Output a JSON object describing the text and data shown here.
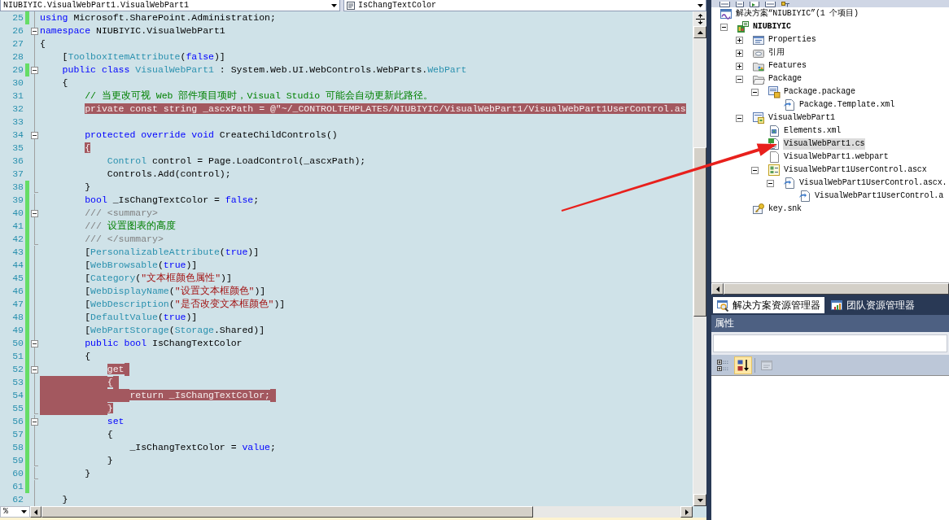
{
  "editor": {
    "type_selector": "NIUBIYIC.VisualWebPart1.VisualWebPart1",
    "member_selector": "IsChangTextColor",
    "lines": [
      {
        "number": "25",
        "kind": "body",
        "changed": true,
        "selected": false,
        "tokens": [
          {
            "text": "using",
            "kind": "keyword",
            "highlighted": false
          },
          {
            "text": " Microsoft.SharePoint.Administration;",
            "kind": "plain",
            "highlighted": false
          }
        ]
      },
      {
        "number": "26",
        "kind": "start",
        "changed": false,
        "selected": false,
        "tokens": [
          {
            "text": "namespace",
            "kind": "keyword",
            "highlighted": false
          },
          {
            "text": " NIUBIYIC.VisualWebPart1",
            "kind": "plain",
            "highlighted": false
          }
        ]
      },
      {
        "number": "27",
        "kind": "body",
        "changed": false,
        "selected": false,
        "tokens": [
          {
            "text": "{",
            "kind": "plain",
            "highlighted": false
          }
        ],
        "children": [
          {
            "number": "28",
            "kind": "body",
            "changed": false,
            "selected": false,
            "tokens": [
              {
                "text": "[",
                "kind": "plain",
                "highlighted": false
              },
              {
                "text": "ToolboxItemAttribute",
                "kind": "type",
                "highlighted": false
              },
              {
                "text": "(",
                "kind": "plain",
                "highlighted": false
              },
              {
                "text": "false",
                "kind": "keyword",
                "highlighted": false
              },
              {
                "text": ")]",
                "kind": "plain",
                "highlighted": false
              }
            ]
          },
          {
            "number": "29",
            "kind": "start",
            "changed": true,
            "selected": false,
            "tokens": [
              {
                "text": "public class ",
                "kind": "keyword",
                "highlighted": false
              },
              {
                "text": "VisualWebPart1",
                "kind": "type",
                "highlighted": false
              },
              {
                "text": " : System.Web.UI.WebControls.WebParts.",
                "kind": "plain",
                "highlighted": false
              },
              {
                "text": "WebPart",
                "kind": "type",
                "highlighted": false
              }
            ]
          },
          {
            "number": "30",
            "kind": "body",
            "changed": false,
            "selected": false,
            "tokens": [
              {
                "text": "{",
                "kind": "plain",
                "highlighted": false
              }
            ],
            "children": [
              {
                "number": "31",
                "kind": "body",
                "changed": false,
                "selected": false,
                "tokens": [
                  {
                    "text": "// 当更改可视 Web 部件项目项时，Visual Studio 可能会自动更新此路径。",
                    "kind": "comment",
                    "highlighted": false
                  }
                ]
              },
              {
                "number": "32",
                "kind": "body",
                "changed": false,
                "selected": false,
                "tokens": [
                  {
                    "text": "private const string",
                    "kind": "keyword",
                    "highlighted": true
                  },
                  {
                    "text": " _ascxPath = ",
                    "kind": "plain",
                    "highlighted": true
                  },
                  {
                    "text": "@\"~/_CONTROLTEMPLATES/NIUBIYIC/VisualWebPart1/VisualWebPart1UserControl.as",
                    "kind": "string",
                    "highlighted": true
                  }
                ]
              },
              {
                "number": "33",
                "kind": "body",
                "changed": false,
                "selected": false
              },
              {
                "number": "34",
                "kind": "start",
                "changed": false,
                "selected": false,
                "tokens": [
                  {
                    "text": "protected override void",
                    "kind": "keyword",
                    "highlighted": false
                  },
                  {
                    "text": " CreateChildControls()",
                    "kind": "plain",
                    "highlighted": false
                  }
                ]
              },
              {
                "number": "35",
                "kind": "body",
                "changed": false,
                "selected": false,
                "tokens": [
                  {
                    "text": "{",
                    "kind": "plain",
                    "highlighted": true
                  }
                ],
                "children": [
                  {
                    "number": "36",
                    "kind": "body",
                    "changed": false,
                    "selected": false,
                    "tokens": [
                      {
                        "text": "Control",
                        "kind": "type",
                        "highlighted": false
                      },
                      {
                        "text": " control = Page.LoadControl(_ascxPath);",
                        "kind": "plain",
                        "highlighted": false
                      }
                    ]
                  },
                  {
                    "number": "37",
                    "kind": "body",
                    "changed": false,
                    "selected": false,
                    "tokens": [
                      {
                        "text": "Controls.Add(control);",
                        "kind": "plain",
                        "highlighted": false
                      }
                    ]
                  }
                ]
              },
              {
                "number": "38",
                "kind": "end",
                "changed": true,
                "selected": false,
                "tokens": [
                  {
                    "text": "}",
                    "kind": "plain",
                    "highlighted": false
                  }
                ]
              },
              {
                "number": "39",
                "kind": "body",
                "changed": true,
                "selected": false,
                "tokens": [
                  {
                    "text": "bool",
                    "kind": "keyword",
                    "highlighted": false
                  },
                  {
                    "text": " _IsChangTextColor = ",
                    "kind": "plain",
                    "highlighted": false
                  },
                  {
                    "text": "false",
                    "kind": "keyword",
                    "highlighted": false
                  },
                  {
                    "text": ";",
                    "kind": "plain",
                    "highlighted": false
                  }
                ]
              },
              {
                "number": "40",
                "kind": "start",
                "changed": true,
                "selected": false,
                "tokens": [
                  {
                    "text": "/// <summary>",
                    "kind": "doc",
                    "highlighted": false
                  }
                ]
              },
              {
                "number": "41",
                "kind": "body",
                "changed": true,
                "selected": false,
                "tokens": [
                  {
                    "text": "/// ",
                    "kind": "doc",
                    "highlighted": false
                  },
                  {
                    "text": "设置图表的高度",
                    "kind": "comment",
                    "highlighted": false
                  }
                ]
              },
              {
                "number": "42",
                "kind": "end",
                "changed": true,
                "selected": false,
                "tokens": [
                  {
                    "text": "/// </summary>",
                    "kind": "doc",
                    "highlighted": false
                  }
                ]
              },
              {
                "number": "43",
                "kind": "body",
                "changed": true,
                "selected": false,
                "tokens": [
                  {
                    "text": "[",
                    "kind": "plain",
                    "highlighted": false
                  },
                  {
                    "text": "PersonalizableAttribute",
                    "kind": "type",
                    "highlighted": false
                  },
                  {
                    "text": "(",
                    "kind": "plain",
                    "highlighted": false
                  },
                  {
                    "text": "true",
                    "kind": "keyword",
                    "highlighted": false
                  },
                  {
                    "text": ")]",
                    "kind": "plain",
                    "highlighted": false
                  }
                ]
              },
              {
                "number": "44",
                "kind": "body",
                "changed": true,
                "selected": false,
                "tokens": [
                  {
                    "text": "[",
                    "kind": "plain",
                    "highlighted": false
                  },
                  {
                    "text": "WebBrowsable",
                    "kind": "type",
                    "highlighted": false
                  },
                  {
                    "text": "(",
                    "kind": "plain",
                    "highlighted": false
                  },
                  {
                    "text": "true",
                    "kind": "keyword",
                    "highlighted": false
                  },
                  {
                    "text": ")]",
                    "kind": "plain",
                    "highlighted": false
                  }
                ]
              },
              {
                "number": "45",
                "kind": "body",
                "changed": true,
                "selected": false,
                "tokens": [
                  {
                    "text": "[",
                    "kind": "plain",
                    "highlighted": false
                  },
                  {
                    "text": "Category",
                    "kind": "type",
                    "highlighted": false
                  },
                  {
                    "text": "(",
                    "kind": "plain",
                    "highlighted": false
                  },
                  {
                    "text": "\"文本框颜色属性\"",
                    "kind": "string",
                    "highlighted": false
                  },
                  {
                    "text": ")]",
                    "kind": "plain",
                    "highlighted": false
                  }
                ]
              },
              {
                "number": "46",
                "kind": "body",
                "changed": true,
                "selected": false,
                "tokens": [
                  {
                    "text": "[",
                    "kind": "plain",
                    "highlighted": false
                  },
                  {
                    "text": "WebDisplayName",
                    "kind": "type",
                    "highlighted": false
                  },
                  {
                    "text": "(",
                    "kind": "plain",
                    "highlighted": false
                  },
                  {
                    "text": "\"设置文本框颜色\"",
                    "kind": "string",
                    "highlighted": false
                  },
                  {
                    "text": ")]",
                    "kind": "plain",
                    "highlighted": false
                  }
                ]
              },
              {
                "number": "47",
                "kind": "body",
                "changed": true,
                "selected": false,
                "tokens": [
                  {
                    "text": "[",
                    "kind": "plain",
                    "highlighted": false
                  },
                  {
                    "text": "WebDescription",
                    "kind": "type",
                    "highlighted": false
                  },
                  {
                    "text": "(",
                    "kind": "plain",
                    "highlighted": false
                  },
                  {
                    "text": "\"是否改变文本框颜色\"",
                    "kind": "string",
                    "highlighted": false
                  },
                  {
                    "text": ")]",
                    "kind": "plain",
                    "highlighted": false
                  }
                ]
              },
              {
                "number": "48",
                "kind": "body",
                "changed": true,
                "selected": false,
                "tokens": [
                  {
                    "text": "[",
                    "kind": "plain",
                    "highlighted": false
                  },
                  {
                    "text": "DefaultValue",
                    "kind": "type",
                    "highlighted": false
                  },
                  {
                    "text": "(",
                    "kind": "plain",
                    "highlighted": false
                  },
                  {
                    "text": "true",
                    "kind": "keyword",
                    "highlighted": false
                  },
                  {
                    "text": ")]",
                    "kind": "plain",
                    "highlighted": false
                  }
                ]
              },
              {
                "number": "49",
                "kind": "body",
                "changed": true,
                "selected": false,
                "tokens": [
                  {
                    "text": "[",
                    "kind": "plain",
                    "highlighted": false
                  },
                  {
                    "text": "WebPartStorage",
                    "kind": "type",
                    "highlighted": false
                  },
                  {
                    "text": "(",
                    "kind": "plain",
                    "highlighted": false
                  },
                  {
                    "text": "Storage",
                    "kind": "type",
                    "highlighted": false
                  },
                  {
                    "text": ".Shared)]",
                    "kind": "plain",
                    "highlighted": false
                  }
                ]
              },
              {
                "number": "50",
                "kind": "start",
                "changed": true,
                "selected": false,
                "tokens": [
                  {
                    "text": "public bool",
                    "kind": "keyword",
                    "highlighted": false
                  },
                  {
                    "text": " IsChangTextColor",
                    "kind": "plain",
                    "highlighted": false
                  }
                ]
              },
              {
                "number": "51",
                "kind": "body",
                "changed": true,
                "selected": false,
                "tokens": [
                  {
                    "text": "{",
                    "kind": "plain",
                    "highlighted": false
                  }
                ],
                "children": [
                  {
                    "number": "52",
                    "kind": "start",
                    "changed": true,
                    "selected": false,
                    "tokens": [
                      {
                        "text": "get",
                        "kind": "keyword",
                        "highlighted": true
                      }
                    ]
                  },
                  {
                    "number": "53",
                    "kind": "body",
                    "changed": true,
                    "selected": true,
                    "tokens": [
                      {
                        "text": "{",
                        "kind": "plain",
                        "highlighted": true
                      }
                    ],
                    "children": [
                      {
                        "number": "54",
                        "kind": "body",
                        "changed": true,
                        "selected": true,
                        "tokens": [
                          {
                            "text": "return",
                            "kind": "keyword",
                            "highlighted": true
                          },
                          {
                            "text": " _IsChangTextColor;",
                            "kind": "plain",
                            "highlighted": true
                          }
                        ]
                      }
                    ]
                  },
                  {
                    "number": "55",
                    "kind": "end",
                    "changed": true,
                    "selected": true,
                    "tokens": [
                      {
                        "text": "}",
                        "kind": "plain",
                        "highlighted": true
                      }
                    ]
                  },
                  {
                    "number": "56",
                    "kind": "start",
                    "changed": true,
                    "selected": false,
                    "tokens": [
                      {
                        "text": "set",
                        "kind": "keyword",
                        "highlighted": false
                      }
                    ]
                  },
                  {
                    "number": "57",
                    "kind": "body",
                    "changed": true,
                    "selected": false,
                    "tokens": [
                      {
                        "text": "{",
                        "kind": "plain",
                        "highlighted": false
                      }
                    ],
                    "children": [
                      {
                        "number": "58",
                        "kind": "body",
                        "changed": true,
                        "selected": false,
                        "tokens": [
                          {
                            "text": "_IsChangTextColor = ",
                            "kind": "plain",
                            "highlighted": false
                          },
                          {
                            "text": "value",
                            "kind": "keyword",
                            "highlighted": false
                          },
                          {
                            "text": ";",
                            "kind": "plain",
                            "highlighted": false
                          }
                        ]
                      }
                    ]
                  },
                  {
                    "number": "59",
                    "kind": "end",
                    "changed": true,
                    "selected": false,
                    "tokens": [
                      {
                        "text": "}",
                        "kind": "plain",
                        "highlighted": false
                      }
                    ]
                  }
                ]
              },
              {
                "number": "60",
                "kind": "end",
                "changed": true,
                "selected": false,
                "tokens": [
                  {
                    "text": "}",
                    "kind": "plain",
                    "highlighted": false
                  }
                ]
              },
              {
                "number": "61",
                "kind": "body",
                "changed": true,
                "selected": false
              }
            ]
          },
          {
            "number": "62",
            "kind": "body",
            "changed": false,
            "selected": false,
            "tokens": [
              {
                "text": "}",
                "kind": "plain",
                "highlighted": false
              }
            ]
          }
        ]
      }
    ],
    "zoom": "%"
  },
  "solution_explorer": {
    "tree": {
      "label": "解决方案“NIUBIYIC”(1 个项目)",
      "kind": "solution",
      "selected": false,
      "children": [
        {
          "label": "NIUBIYIC",
          "kind": "project",
          "selected": false,
          "expanded": true,
          "children": [
            {
              "label": "Properties",
              "kind": "properties",
              "selected": false,
              "expanded": false
            },
            {
              "label": "引用",
              "kind": "references",
              "selected": false,
              "expanded": false
            },
            {
              "label": "Features",
              "kind": "features",
              "selected": false,
              "expanded": false
            },
            {
              "label": "Package",
              "kind": "folder",
              "selected": false,
              "expanded": true,
              "children": [
                {
                  "label": "Package.package",
                  "kind": "package",
                  "selected": false,
                  "expanded": true,
                  "children": [
                    {
                      "label": "Package.Template.xml",
                      "kind": "linked",
                      "selected": false
                    }
                  ]
                }
              ]
            },
            {
              "label": "VisualWebPart1",
              "kind": "webpart",
              "selected": false,
              "expanded": true,
              "children": [
                {
                  "label": "Elements.xml",
                  "kind": "xml",
                  "selected": false
                },
                {
                  "label": "VisualWebPart1.cs",
                  "kind": "csharp",
                  "selected": true
                },
                {
                  "label": "VisualWebPart1.webpart",
                  "kind": "file",
                  "selected": false
                },
                {
                  "label": "VisualWebPart1UserControl.ascx",
                  "kind": "user_control",
                  "selected": false,
                  "expanded": true,
                  "children": [
                    {
                      "label": "VisualWebPart1UserControl.ascx.",
                      "kind": "linked",
                      "selected": false,
                      "expanded": true,
                      "children": [
                        {
                          "label": "VisualWebPart1UserControl.a",
                          "kind": "linked",
                          "selected": false
                        }
                      ]
                    }
                  ]
                }
              ]
            },
            {
              "label": "key.snk",
              "kind": "key",
              "selected": false
            }
          ]
        }
      ]
    }
  },
  "tabs": [
    {
      "label": "解决方案资源管理器",
      "kind": "solution_explorer",
      "selected": true
    },
    {
      "label": "团队资源管理器",
      "kind": "team_explorer",
      "selected": false
    }
  ],
  "properties": {
    "title": "属性",
    "toolbar": [
      {
        "kind": "categorized",
        "selected": false,
        "disabled": false
      },
      {
        "kind": "alphabetical",
        "selected": true,
        "disabled": false
      },
      {
        "kind": "property_pages",
        "selected": false,
        "disabled": true
      }
    ]
  }
}
